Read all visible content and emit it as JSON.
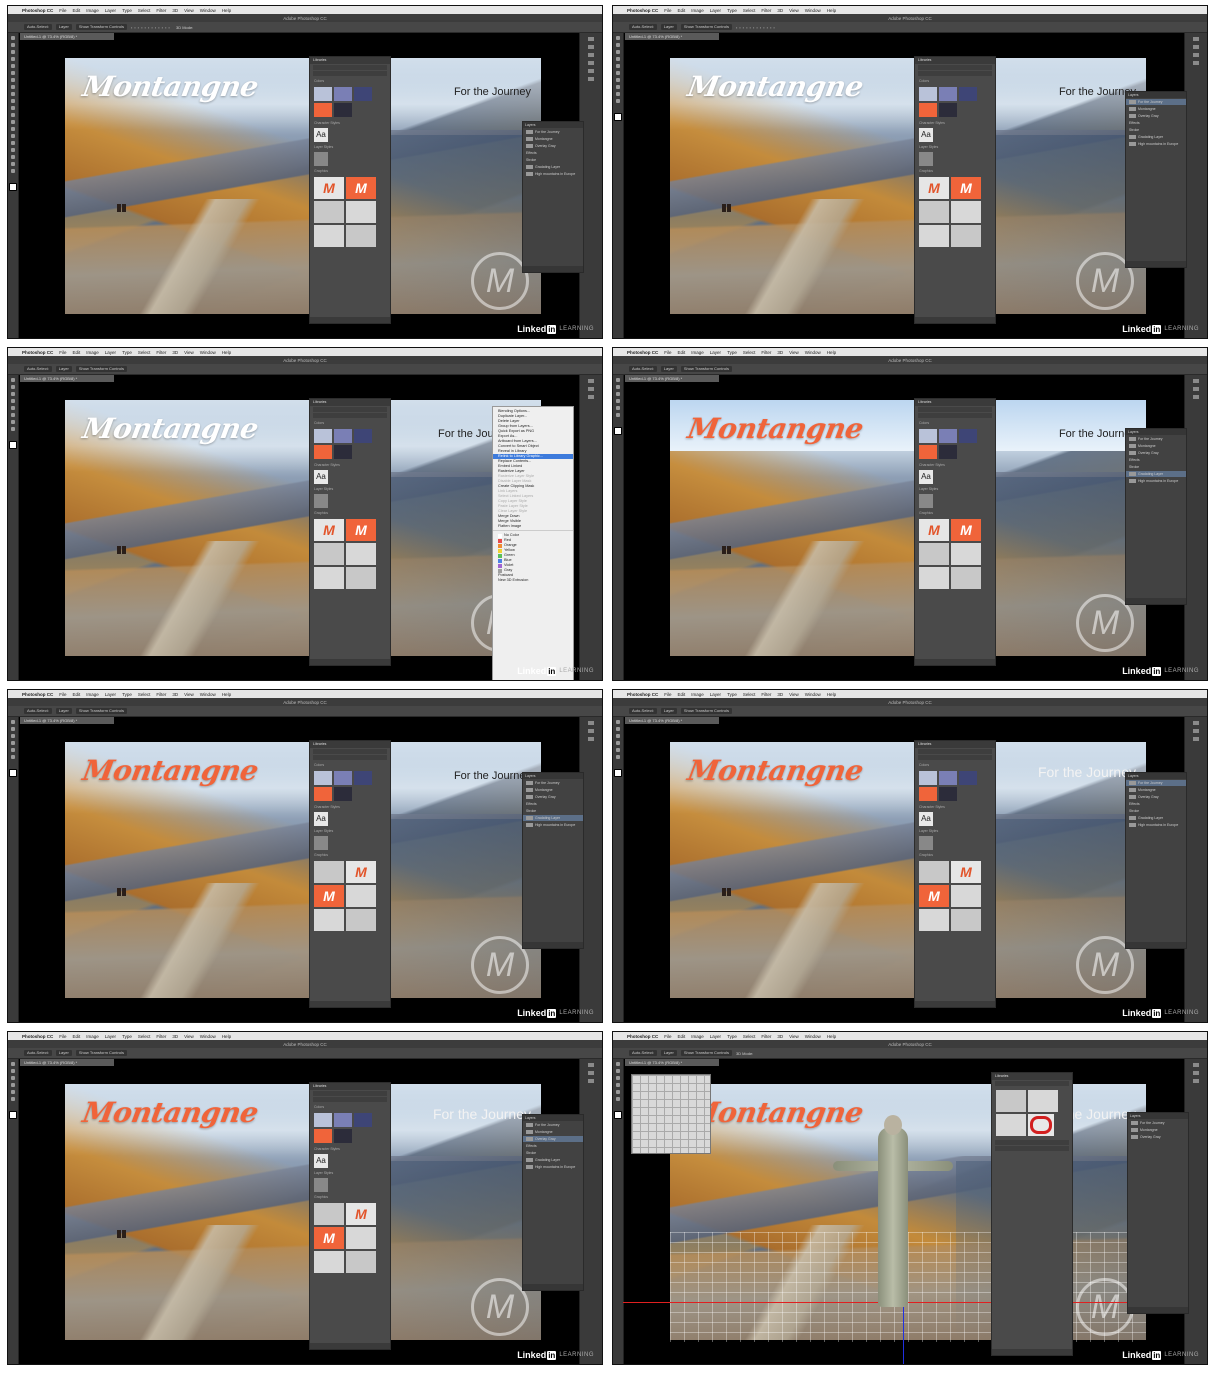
{
  "app": {
    "apple_glyph": "",
    "name": "Photoshop CC",
    "menus": [
      "File",
      "Edit",
      "Image",
      "Layer",
      "Type",
      "Select",
      "Filter",
      "3D",
      "View",
      "Window",
      "Help"
    ],
    "window_title": "Adobe Photoshop CC"
  },
  "options_bar": {
    "auto_select": "Auto-Select:",
    "auto_select_value": "Layer",
    "show_transform": "Show Transform Controls",
    "mode_3d": "3D Mode:"
  },
  "document": {
    "tab_label": "Untitled-1 @ 73.4% (RGB/8) *"
  },
  "artwork": {
    "logo_text": "Montangne",
    "tagline": "For the Journey",
    "watermark_letter": "M"
  },
  "libraries_panel": {
    "title": "Libraries",
    "sections": {
      "colors": "Colors",
      "character_styles": "Character Styles",
      "layer_styles": "Layer Styles",
      "graphics": "Graphics"
    },
    "char_style_sample": "Aa",
    "graphic_letter": "M",
    "swatch_colors": [
      "#b9c2d9",
      "#7a7fb5",
      "#3e4576",
      "#f0643a",
      "#2c2c3a"
    ]
  },
  "layers_panel": {
    "title": "Layers",
    "rows": [
      "For the Journey",
      "Montangne",
      "Overlay Gray",
      "Effects",
      "Stroke",
      "Gradating Layer",
      "High mountains in Europe"
    ]
  },
  "context_menu": {
    "items": [
      {
        "label": "Blending Options...",
        "state": "normal"
      },
      {
        "label": "Duplicate Layer...",
        "state": "normal"
      },
      {
        "label": "Delete Layer",
        "state": "normal"
      },
      {
        "label": "Group from Layers...",
        "state": "normal"
      },
      {
        "label": "Quick Export as PNG",
        "state": "normal"
      },
      {
        "label": "Export As...",
        "state": "normal"
      },
      {
        "label": "Artboard from Layers...",
        "state": "normal"
      },
      {
        "label": "Convert to Smart Object",
        "state": "normal"
      },
      {
        "label": "Reveal in Library",
        "state": "normal"
      },
      {
        "label": "Relink to Library Graphic...",
        "state": "highlight"
      },
      {
        "label": "Replace Contents...",
        "state": "normal"
      },
      {
        "label": "Embed Linked",
        "state": "normal"
      },
      {
        "label": "Rasterize Layer",
        "state": "normal"
      },
      {
        "label": "Rasterize Layer Style",
        "state": "disabled"
      },
      {
        "label": "Disable Layer Mask",
        "state": "disabled"
      },
      {
        "label": "Create Clipping Mask",
        "state": "normal"
      },
      {
        "label": "Link Layers",
        "state": "disabled"
      },
      {
        "label": "Select Linked Layers",
        "state": "disabled"
      },
      {
        "label": "Copy Layer Style",
        "state": "disabled"
      },
      {
        "label": "Paste Layer Style",
        "state": "disabled"
      },
      {
        "label": "Clear Layer Style",
        "state": "disabled"
      },
      {
        "label": "Merge Down",
        "state": "normal"
      },
      {
        "label": "Merge Visible",
        "state": "normal"
      },
      {
        "label": "Flatten Image",
        "state": "normal"
      }
    ],
    "colors": [
      {
        "label": "No Color",
        "hex": "#ffffff"
      },
      {
        "label": "Red",
        "hex": "#e64b4b"
      },
      {
        "label": "Orange",
        "hex": "#f08c32"
      },
      {
        "label": "Yellow",
        "hex": "#f0d232"
      },
      {
        "label": "Green",
        "hex": "#5abe5a"
      },
      {
        "label": "Blue",
        "hex": "#4b82e6"
      },
      {
        "label": "Violet",
        "hex": "#a064d2"
      },
      {
        "label": "Gray",
        "hex": "#a0a0a0"
      }
    ],
    "footer": [
      "Postcard",
      "New 3D Extrusion"
    ]
  },
  "branding": {
    "linked": "Linked",
    "in": "in",
    "learning": "LEARNING"
  }
}
